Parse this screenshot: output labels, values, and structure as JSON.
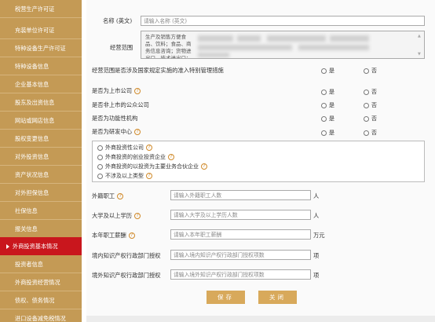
{
  "sidebar": {
    "items": [
      {
        "label": "税营生产许可证"
      },
      {
        "label": "充装单位许可证"
      },
      {
        "label": "特种设备生产许可证"
      },
      {
        "label": "特种设备信息"
      },
      {
        "label": "企业基本信息"
      },
      {
        "label": "股东及出资信息"
      },
      {
        "label": "网站或网店信息"
      },
      {
        "label": "股权变更信息"
      },
      {
        "label": "对外投资信息"
      },
      {
        "label": "资产状况信息"
      },
      {
        "label": "对外担保信息"
      },
      {
        "label": "社保信息"
      },
      {
        "label": "报关信息"
      },
      {
        "label": "外商投资基本情况"
      },
      {
        "label": "投资者信息"
      },
      {
        "label": "外商投资经营情况"
      },
      {
        "label": "债权、债务情况"
      },
      {
        "label": "进口设备减免税情况"
      }
    ],
    "active_index": 13
  },
  "form": {
    "name_en_label": "名称 (英文)",
    "name_en_placeholder": "请输入名称 (英文)",
    "scope_label": "经营范围",
    "scope_text": "生产及销售方便食品、饮料；食品、商务信息咨询；货物进出口、技术进出口；食品生产经营。",
    "q_special_label": "经营范围是否涉及国家规定实施的准入特别管理措施",
    "q_listed_label": "是否为上市公司",
    "q_nonlisted_label": "是否非上市的公众公司",
    "q_functional_label": "是否为功能性机构",
    "q_rnd_label": "是否为研发中心",
    "yes": "是",
    "no": "否",
    "invest_options": [
      "外商投资性公司",
      "外商投资的创业投资企业",
      "外商投资的以投资为主要业务合伙企业",
      "不涉及以上类型"
    ],
    "foreign_staff_label": "外籍职工",
    "foreign_staff_placeholder": "请输入外籍职工人数",
    "foreign_staff_unit": "人",
    "college_label": "大学及以上学历",
    "college_placeholder": "请输入大学及以上学历人数",
    "college_unit": "人",
    "salary_label": "本年职工薪酬",
    "salary_placeholder": "请输入本年职工薪酬",
    "salary_unit": "万元",
    "ip_domestic_label": "境内知识产权行政部门授权",
    "ip_domestic_placeholder": "请输入境内知识产权行政部门授权项数",
    "ip_domestic_unit": "项",
    "ip_foreign_label": "境外知识产权行政部门授权",
    "ip_foreign_placeholder": "请输入境外知识产权行政部门授权项数",
    "ip_foreign_unit": "项",
    "save_label": "保存",
    "close_label": "关闭"
  },
  "colors": {
    "sidebar_bg": "#c49a55",
    "sidebar_active": "#c9161d",
    "button_bg": "#d8a95b"
  }
}
